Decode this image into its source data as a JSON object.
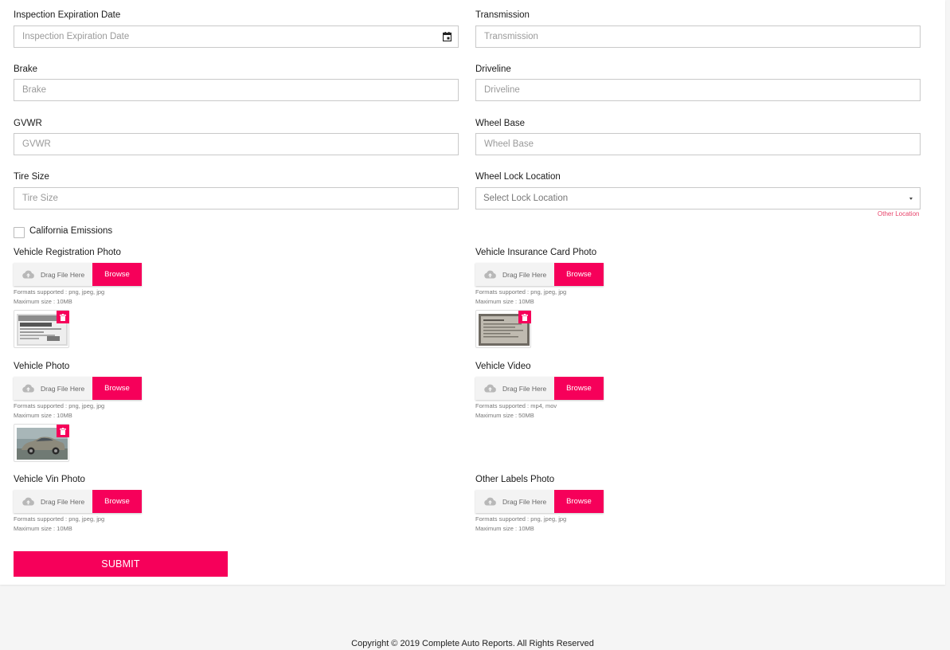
{
  "fields": {
    "inspection_expiration": {
      "label": "Inspection Expiration Date",
      "placeholder": "Inspection Expiration Date"
    },
    "transmission": {
      "label": "Transmission",
      "placeholder": "Transmission"
    },
    "brake": {
      "label": "Brake",
      "placeholder": "Brake"
    },
    "driveline": {
      "label": "Driveline",
      "placeholder": "Driveline"
    },
    "gvwr": {
      "label": "GVWR",
      "placeholder": "GVWR"
    },
    "wheel_base": {
      "label": "Wheel Base",
      "placeholder": "Wheel Base"
    },
    "tire_size": {
      "label": "Tire Size",
      "placeholder": "Tire Size"
    },
    "wheel_lock_location": {
      "label": "Wheel Lock Location",
      "selected": "Select Lock Location",
      "other_link": "Other Location"
    }
  },
  "california_emissions": {
    "label": "California Emissions",
    "checked": false
  },
  "uploads": {
    "drag_text": "Drag File Here",
    "browse_label": "Browse",
    "vehicle_registration": {
      "label": "Vehicle Registration Photo",
      "formats": "Formats supported : png, jpeg, jpg",
      "max_size": "Maximum size : 10MB"
    },
    "vehicle_insurance": {
      "label": "Vehicle Insurance Card Photo",
      "formats": "Formats supported : png, jpeg, jpg",
      "max_size": "Maximum size : 10MB"
    },
    "vehicle_photo": {
      "label": "Vehicle Photo",
      "formats": "Formats supported : png, jpeg, jpg",
      "max_size": "Maximum size : 10MB"
    },
    "vehicle_video": {
      "label": "Vehicle Video",
      "formats": "Formats supported : mp4, mov",
      "max_size": "Maximum size : 50MB"
    },
    "vehicle_vin": {
      "label": "Vehicle Vin Photo",
      "formats": "Formats supported : png, jpeg, jpg",
      "max_size": "Maximum size : 10MB"
    },
    "other_labels": {
      "label": "Other Labels Photo",
      "formats": "Formats supported : png, jpeg, jpg",
      "max_size": "Maximum size : 10MB"
    }
  },
  "submit_label": "SUBMIT",
  "footer": {
    "copyright": "Copyright © 2019 Complete Auto Reports. All Rights Reserved"
  },
  "colors": {
    "accent": "#f6005a",
    "link": "#e8436a",
    "border": "#c9c9c9",
    "page_bg": "#f5f5f5"
  },
  "icons": [
    "calendar-icon",
    "chevron-down-icon",
    "upload-cloud-icon",
    "trash-icon"
  ]
}
